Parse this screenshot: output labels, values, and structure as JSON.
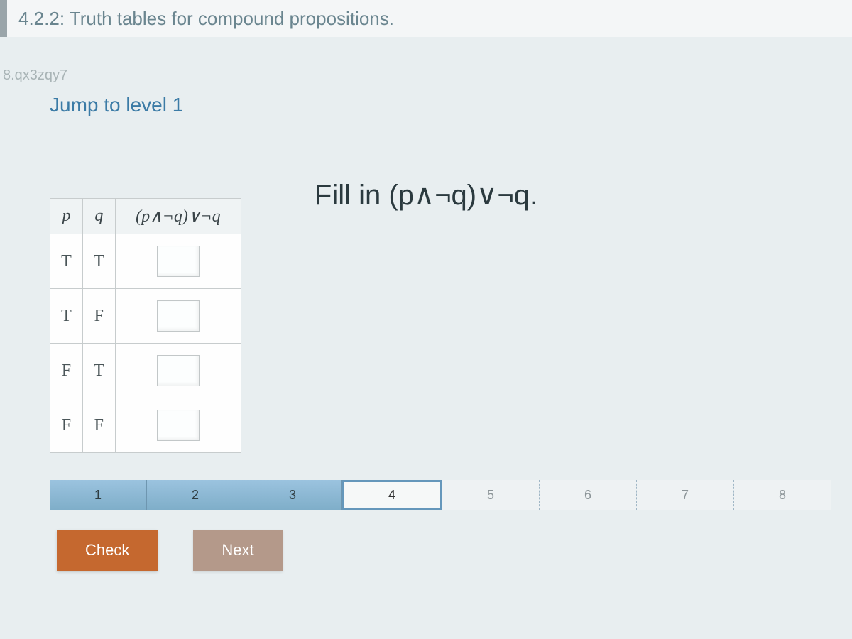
{
  "section_title": "4.2.2: Truth tables for compound propositions.",
  "watermark": "8.qx3zqy7",
  "jump_link_label": "Jump to level 1",
  "prompt_text": "Fill in (p∧¬q)∨¬q.",
  "table": {
    "headers": {
      "p": "p",
      "q": "q",
      "expr": "(p∧¬q)∨¬q"
    },
    "rows": [
      {
        "p": "T",
        "q": "T",
        "ans": ""
      },
      {
        "p": "T",
        "q": "F",
        "ans": ""
      },
      {
        "p": "F",
        "q": "T",
        "ans": ""
      },
      {
        "p": "F",
        "q": "F",
        "ans": ""
      }
    ]
  },
  "progress": {
    "segments": [
      {
        "label": "1",
        "state": "done"
      },
      {
        "label": "2",
        "state": "done"
      },
      {
        "label": "3",
        "state": "done"
      },
      {
        "label": "4",
        "state": "current"
      },
      {
        "label": "5",
        "state": "future"
      },
      {
        "label": "6",
        "state": "future"
      },
      {
        "label": "7",
        "state": "future"
      },
      {
        "label": "8",
        "state": "future"
      }
    ]
  },
  "buttons": {
    "check": "Check",
    "next": "Next"
  }
}
